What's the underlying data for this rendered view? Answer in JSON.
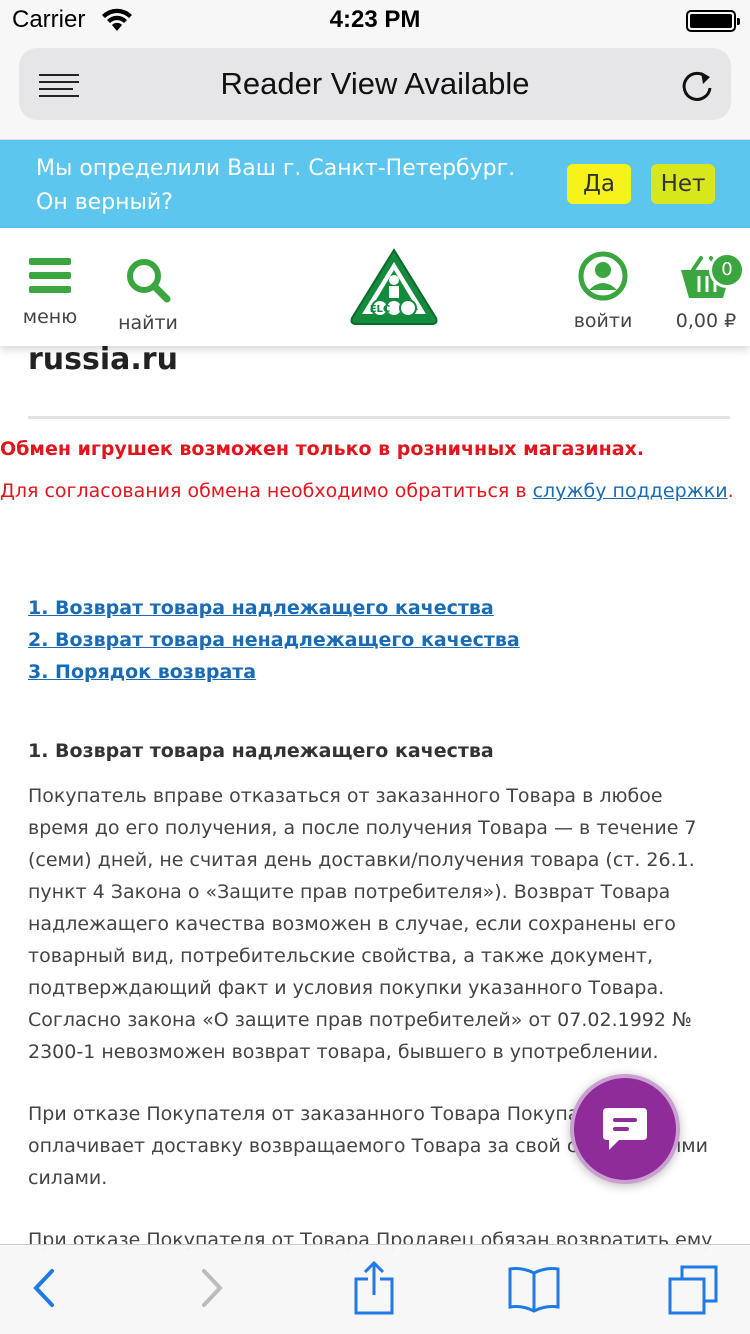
{
  "status_bar": {
    "carrier": "Carrier",
    "time": "4:23 PM"
  },
  "browser": {
    "address_title": "Reader View Available",
    "icons": {
      "reader": "reader-view-icon",
      "reload": "reload-icon"
    }
  },
  "city_banner": {
    "question": "Мы определили Ваш г. Санкт-Петербург. Он верный?",
    "yes_label": "Да",
    "no_label": "Нет"
  },
  "site_header": {
    "menu_label": "меню",
    "search_label": "найти",
    "login_label": "войти",
    "cart_count": "0",
    "cart_total": "0,00 ₽",
    "logo_letters": "ELC",
    "colors": {
      "brand_green": "#3aa63f",
      "banner_blue": "#5cc6ee",
      "button_yellow": "#f5f31a"
    }
  },
  "content": {
    "domain_text": "russia.ru",
    "notice_bold": "Обмен игрушек возможен только в розничных магазинах.",
    "notice_prefix": "Для согласования обмена необходимо обратиться в ",
    "notice_link": "службу поддержки",
    "notice_suffix": ".",
    "toc": [
      "1. Возврат товара надлежащего качества",
      "2. Возврат товара ненадлежащего качества",
      "3. Порядок возврата"
    ],
    "section1_heading": "1. Возврат товара надлежащего качества",
    "section1_para": "Покупатель вправе отказаться от заказанного Товара в любое время до его получения, а после получения Товара — в течение 7 (семи) дней, не считая день доставки/получения товара (ст. 26.1. пункт 4 Закона о «Защите прав потребителя»). Возврат Товара надлежащего качества возможен в случае, если сохранены его товарный вид, потребительские свойства, а также документ, подтверждающий факт и условия покупки указанного Товара. Согласно закона «О защите прав потребителей» от 07.02.1992 № 2300-1 невозможен возврат товара, бывшего в употреблении.",
    "section1_para2": "При отказе Покупателя от заказанного Товара Покупатель оплачивает доставку возвращаемого Товара за свой счет и своими силами.",
    "section1_para3_partial": "При отказе Покупателя от Товара Продавец обязан возвратить ему"
  },
  "chat_widget": {
    "icon": "chat-icon",
    "color": "#8e2c9a"
  },
  "toolbar": {
    "icons": [
      "back-icon",
      "forward-icon",
      "share-icon",
      "bookmarks-icon",
      "tabs-icon"
    ]
  }
}
